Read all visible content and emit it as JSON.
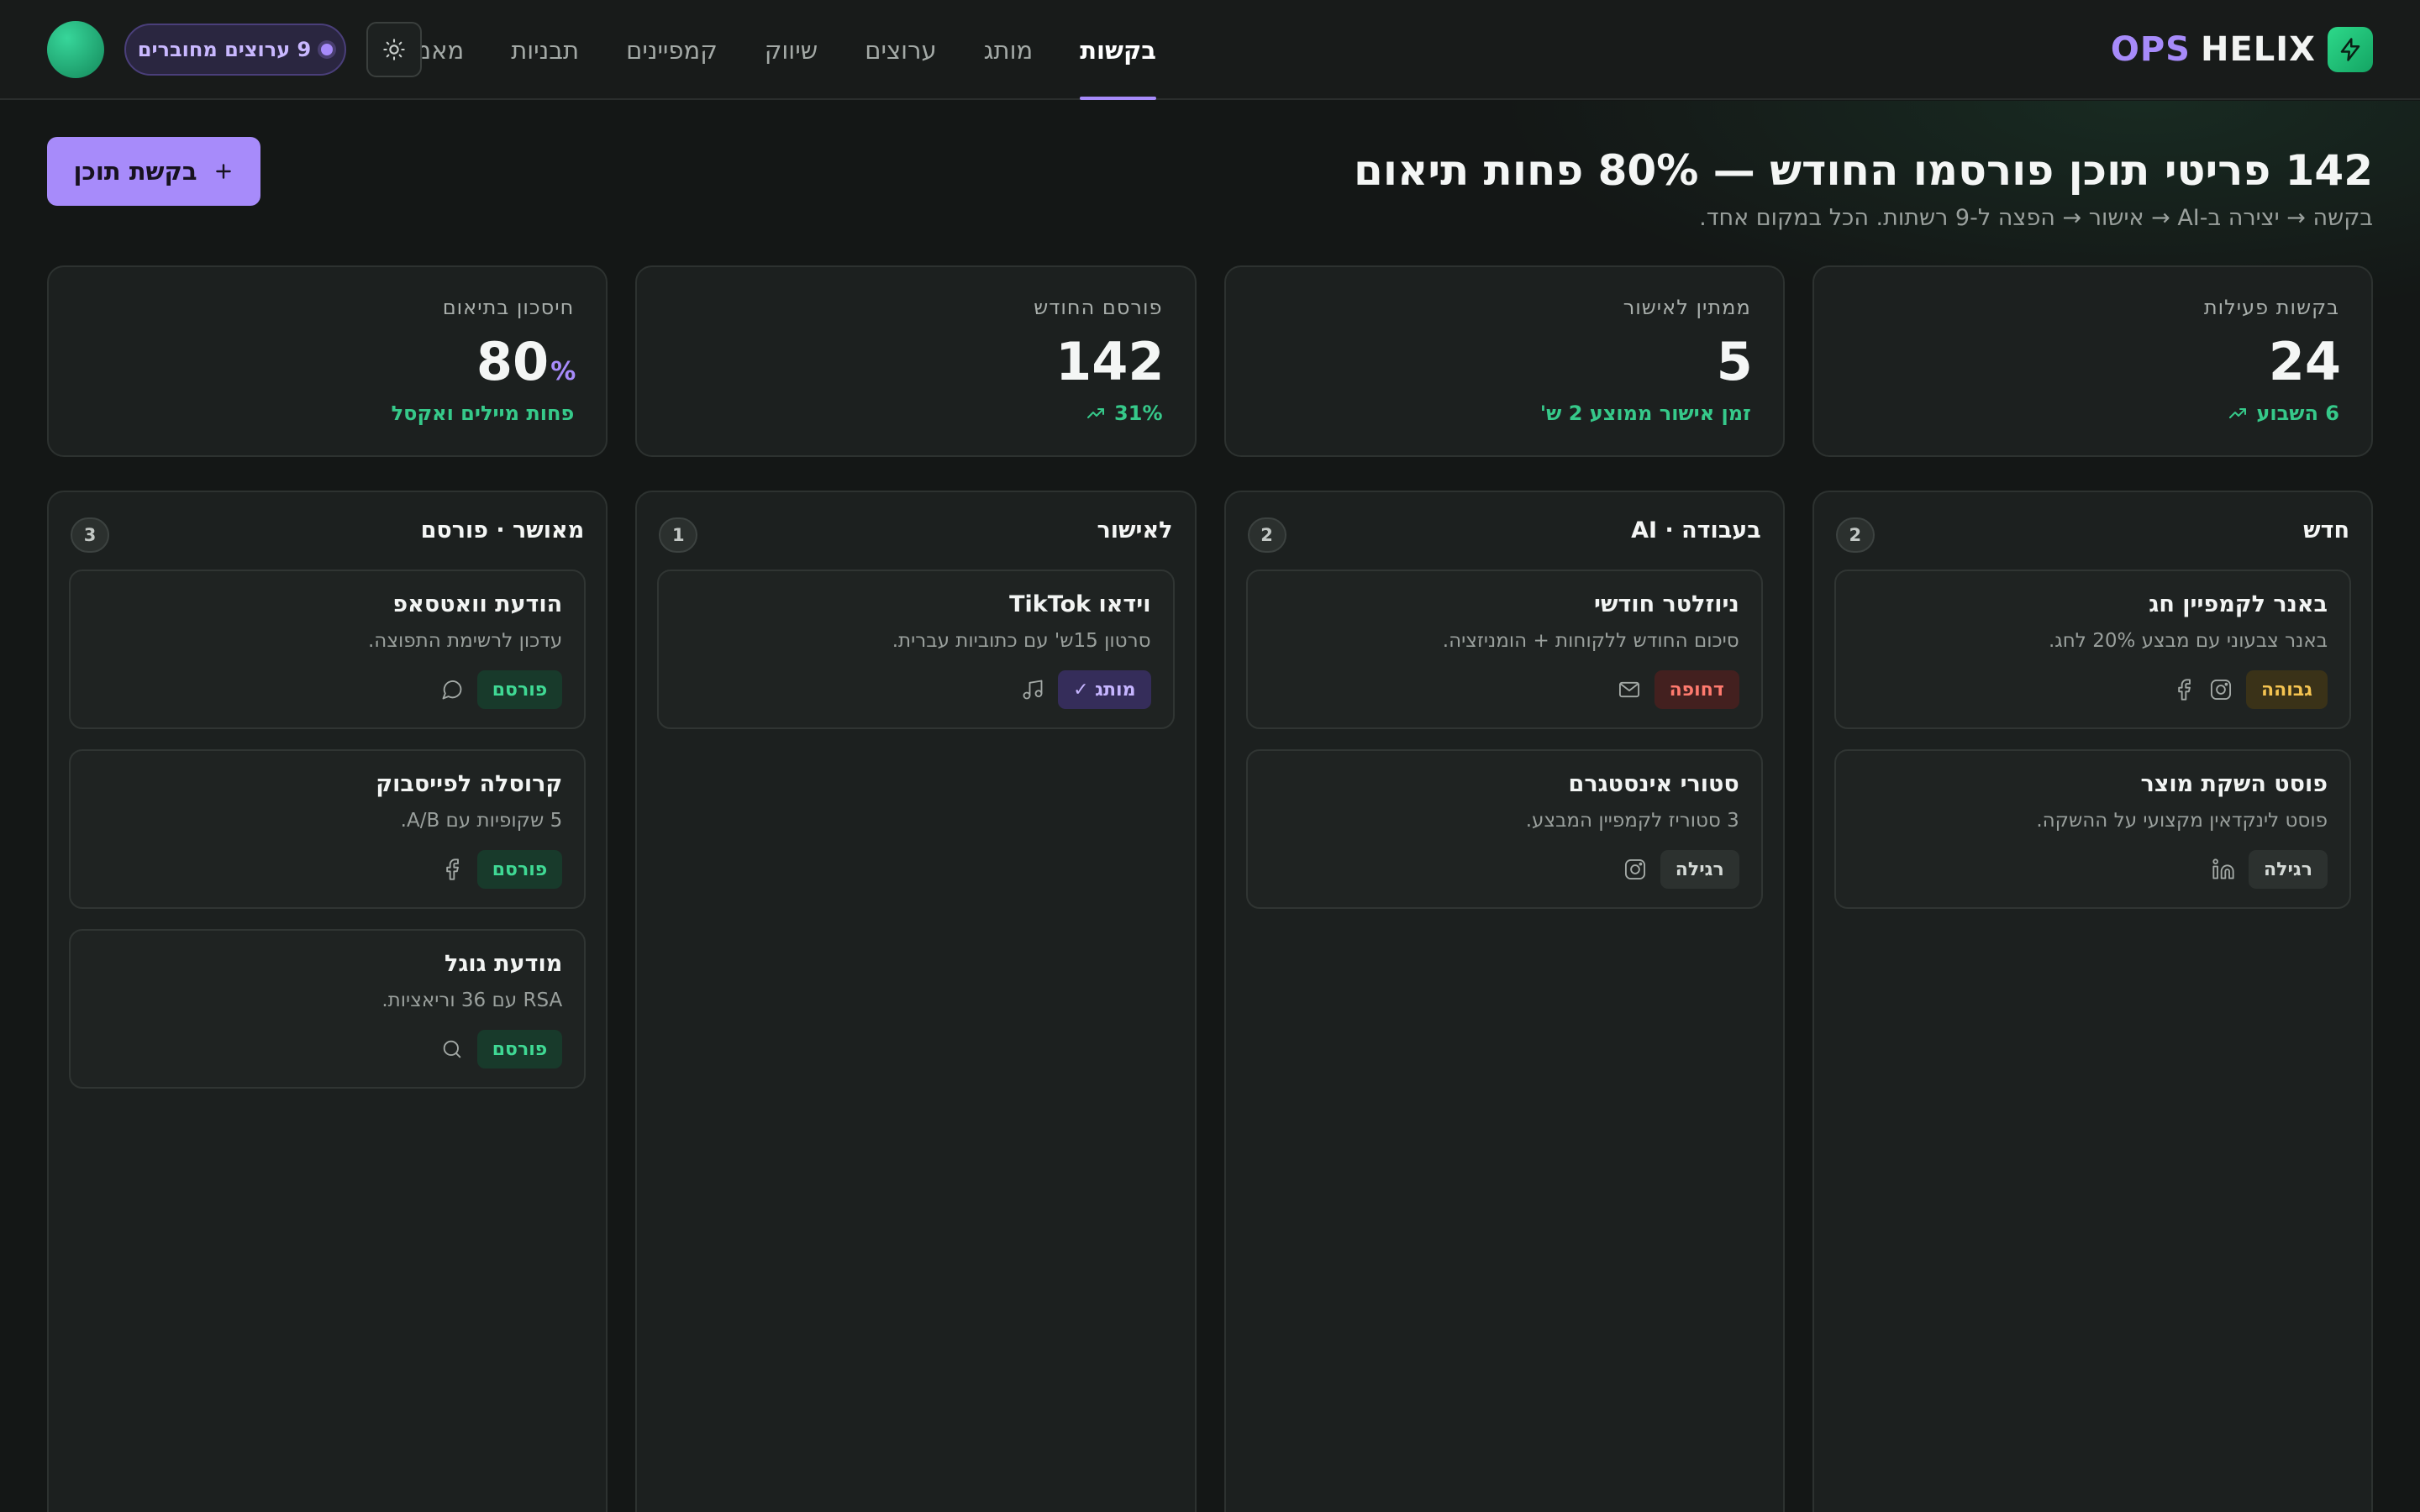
{
  "brand": {
    "name_accent": "OPS",
    "name": "HELIX"
  },
  "nav": [
    {
      "label": "בקשות",
      "active": true
    },
    {
      "label": "מותג"
    },
    {
      "label": "ערוצים"
    },
    {
      "label": "שיווק"
    },
    {
      "label": "קמפיינים"
    },
    {
      "label": "תבניות"
    },
    {
      "label": "מאמן"
    }
  ],
  "header": {
    "viewers_label": "9 ערוצים מחוברים"
  },
  "hero": {
    "title": "142 פריטי תוכן פורסמו החודש — 80% פחות תיאום",
    "subtitle": "בקשה → יצירה ב-AI → אישור → הפצה ל-9 רשתות. הכל במקום אחד.",
    "cta_label": "בקשת תוכן"
  },
  "stats": [
    {
      "label": "בקשות פעילות",
      "value": "24",
      "unit": "",
      "note": "6 השבוע",
      "trend_icon": "trend-up-icon"
    },
    {
      "label": "ממתין לאישור",
      "value": "5",
      "unit": "",
      "note": "זמן אישור ממוצע 2 ש'",
      "trend_icon": ""
    },
    {
      "label": "פורסם החודש",
      "value": "142",
      "unit": "",
      "note": "31%",
      "trend_icon": "trend-up-icon"
    },
    {
      "label": "חיסכון בתיאום",
      "value": "80",
      "unit": "%",
      "note": "פחות מיילים ואקסל",
      "trend_icon": ""
    }
  ],
  "columns": [
    {
      "title": "חדש",
      "count": "2",
      "cards": [
        {
          "title": "באנר לקמפיין חג",
          "desc": "באנר צבעוני עם מבצע 20% לחג.",
          "badge": "גבוהה",
          "badge_type": "high",
          "icons": [
            "facebook-icon",
            "instagram-icon"
          ]
        },
        {
          "title": "פוסט השקת מוצר",
          "desc": "פוסט לינקדאין מקצועי על ההשקה.",
          "badge": "רגילה",
          "badge_type": "normal",
          "icons": [
            "linkedin-icon"
          ]
        }
      ]
    },
    {
      "title": "בעבודה · AI",
      "count": "2",
      "cards": [
        {
          "title": "ניוזלטר חודשי",
          "desc": "סיכום החודש ללקוחות + הומניזציה.",
          "badge": "דחופה",
          "badge_type": "urgent",
          "icons": [
            "mail-icon"
          ]
        },
        {
          "title": "סטורי אינסטגרם",
          "desc": "3 סטוריז לקמפיין המבצע.",
          "badge": "רגילה",
          "badge_type": "normal",
          "icons": [
            "instagram-icon"
          ]
        }
      ]
    },
    {
      "title": "לאישור",
      "count": "1",
      "cards": [
        {
          "title": "וידאו TikTok",
          "desc": "סרטון 15ש' עם כתוביות עברית.",
          "badge": "מותג ✓",
          "badge_type": "branded",
          "icons": [
            "music-note-icon"
          ]
        }
      ]
    },
    {
      "title": "מאושר · פורסם",
      "count": "3",
      "cards": [
        {
          "title": "הודעת וואטסאפ",
          "desc": "עדכון לרשימת התפוצה.",
          "badge": "פורסם",
          "badge_type": "published",
          "icons": [
            "chat-bubble-icon"
          ]
        },
        {
          "title": "קרוסלה לפייסבוק",
          "desc": "5 שקופיות עם A/B.",
          "badge": "פורסם",
          "badge_type": "published",
          "icons": [
            "facebook-icon"
          ]
        },
        {
          "title": "מודעת גוגל",
          "desc": "RSA עם 36 וריאציות.",
          "badge": "פורסם",
          "badge_type": "published",
          "icons": [
            "search-icon"
          ]
        }
      ]
    }
  ],
  "colors": {
    "accent": "#a78bfa",
    "success": "#36c98a",
    "background": "#141716",
    "surface": "#1c201f"
  }
}
